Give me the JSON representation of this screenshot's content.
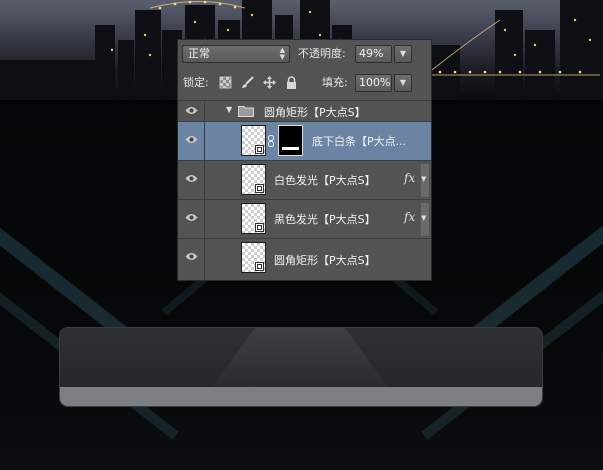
{
  "toolbar": {
    "blend_mode": "正常",
    "opacity_label": "不透明度:",
    "opacity_value": "49%",
    "lock_label": "锁定:",
    "fill_label": "填充:",
    "fill_value": "100%"
  },
  "layers_panel": {
    "group": {
      "name": "圆角矩形【P大点S】"
    },
    "layers": [
      {
        "name": "底下白条【P大点...",
        "selected": true,
        "has_mask": true,
        "has_fx": false
      },
      {
        "name": "白色发光【P大点S】",
        "selected": false,
        "has_mask": false,
        "has_fx": true,
        "fx_label": "fx"
      },
      {
        "name": "黑色发光【P大点S】",
        "selected": false,
        "has_mask": false,
        "has_fx": true,
        "fx_label": "fx"
      },
      {
        "name": "圆角矩形【P大点S】",
        "selected": false,
        "has_mask": false,
        "has_fx": false
      }
    ]
  },
  "icons": {
    "eye": "eye-icon",
    "folder": "folder-icon",
    "chain": "chain-link-icon",
    "lock_transparent": "checker-lock-icon",
    "lock_brush": "brush-lock-icon",
    "lock_move": "move-lock-icon",
    "lock_all": "padlock-icon"
  },
  "colors": {
    "panel_bg": "#535353",
    "selected_row": "#6c84a4",
    "glass_bottom": "#7b7f83"
  }
}
